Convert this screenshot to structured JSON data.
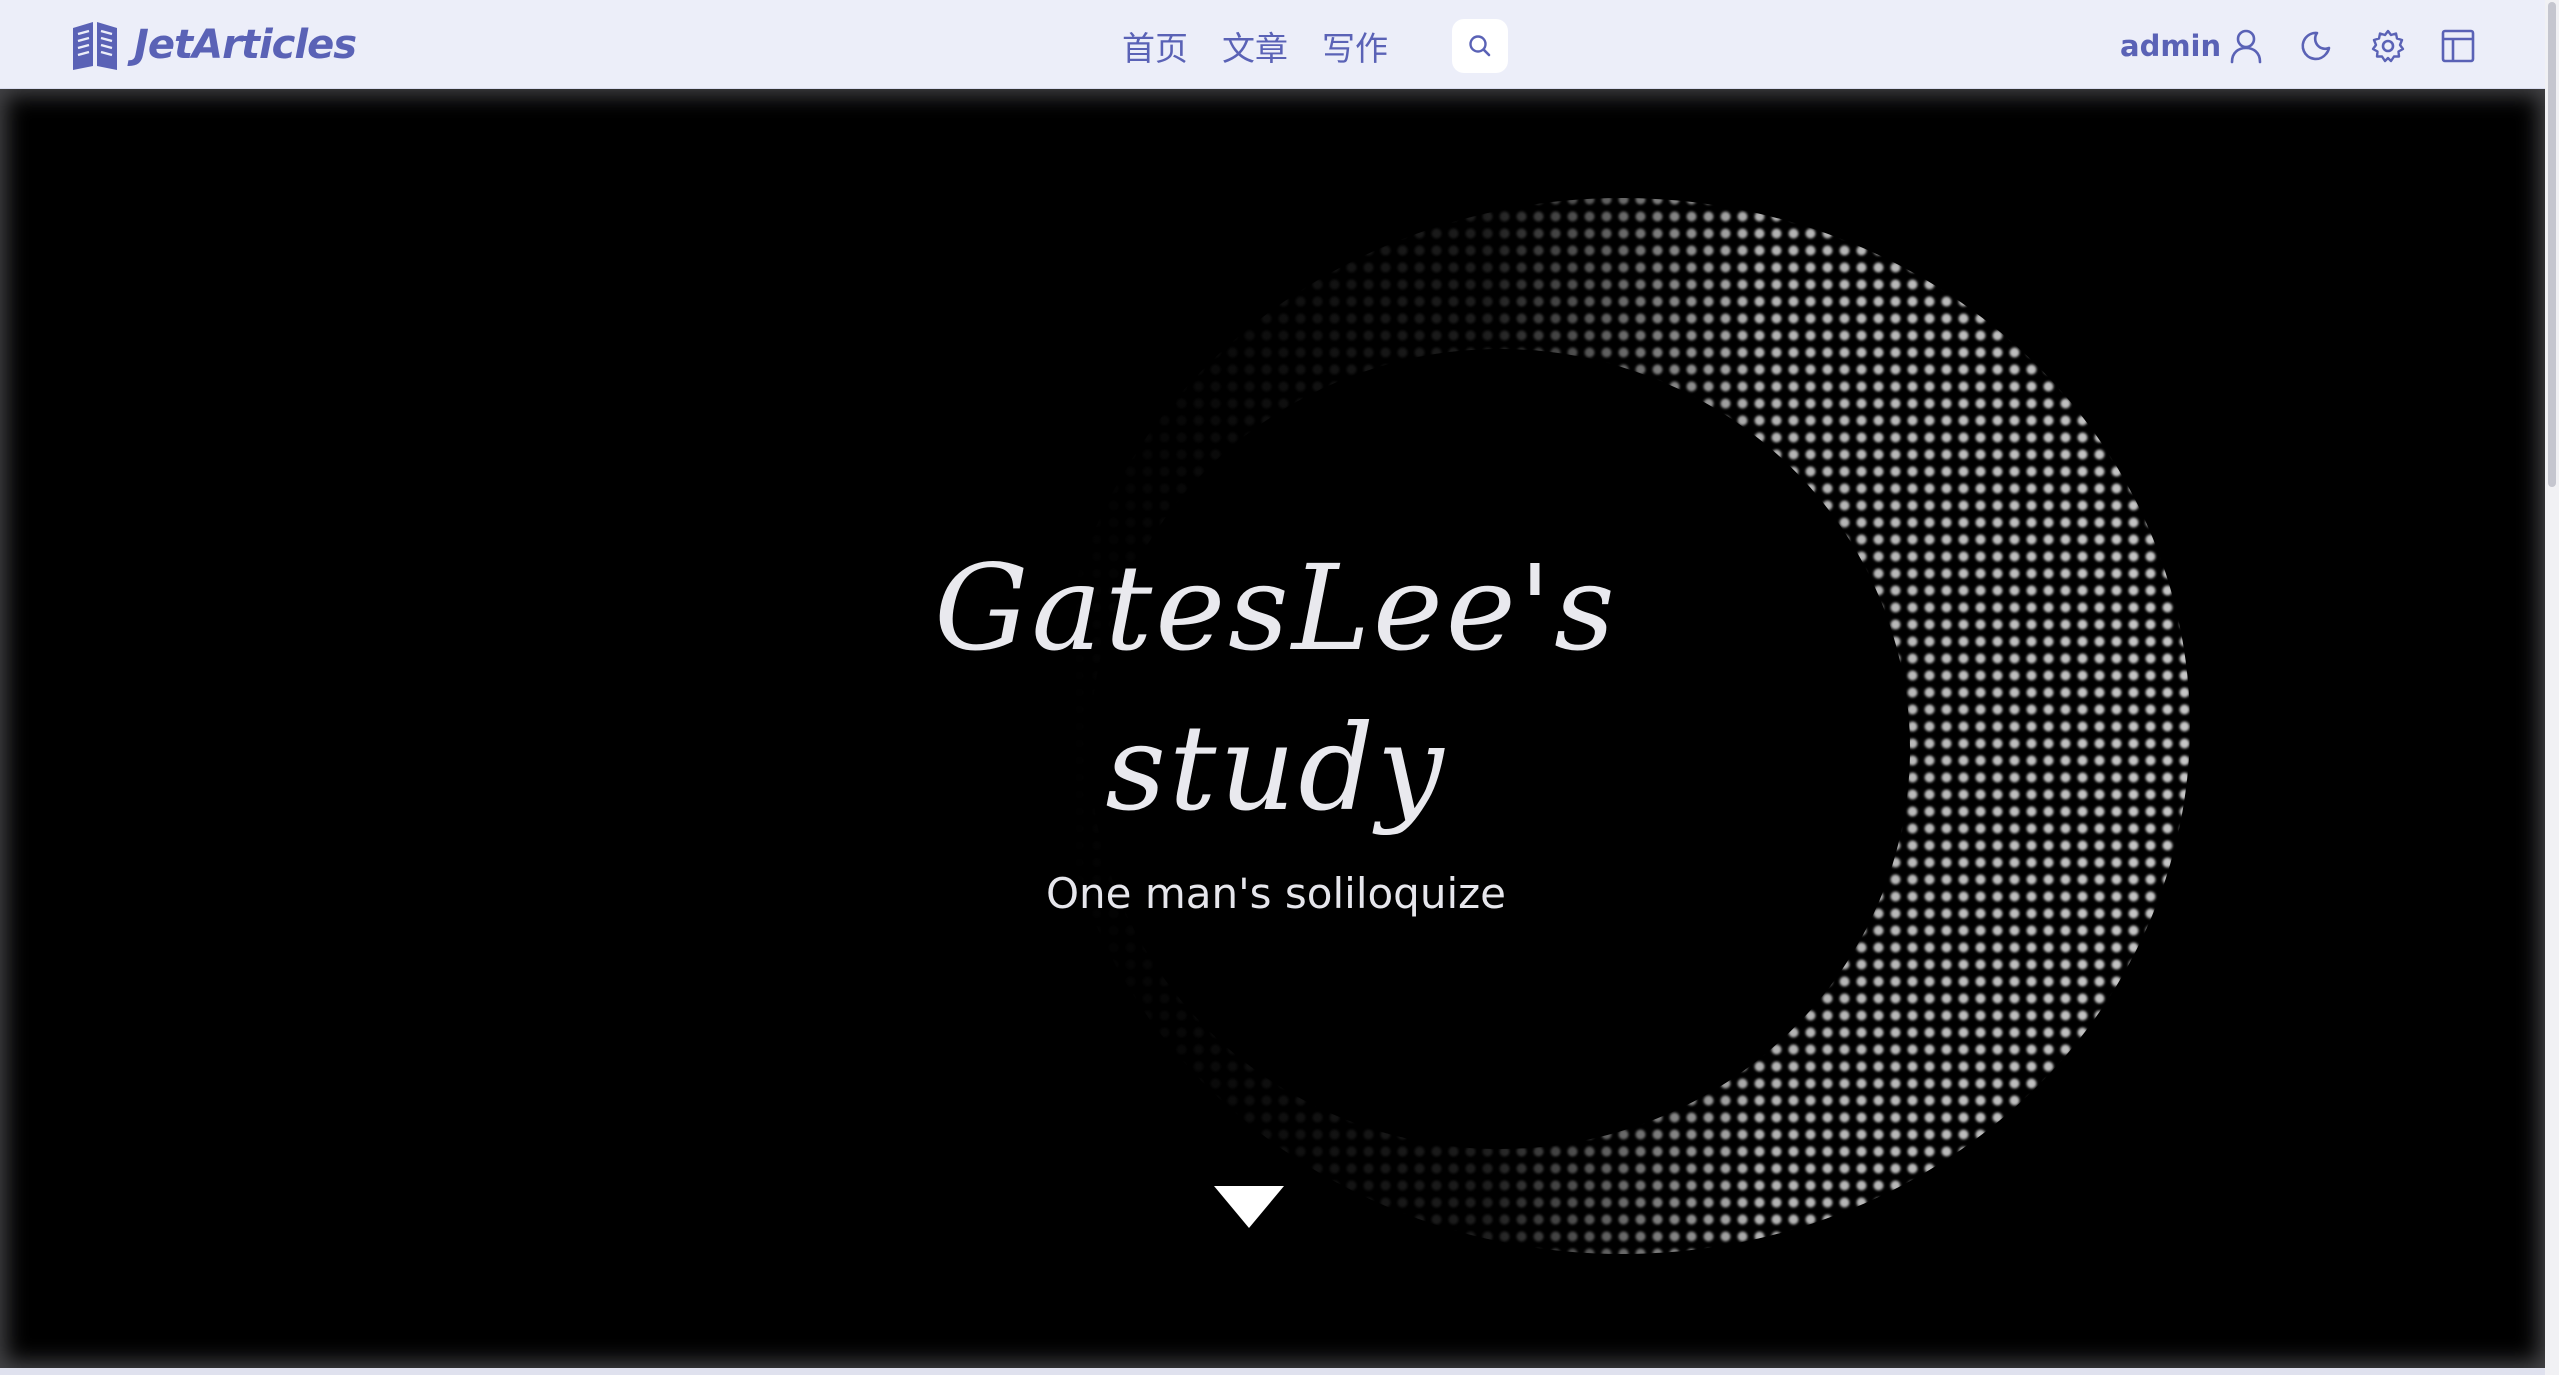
{
  "header": {
    "brand": {
      "name": "JetArticles",
      "icon": "open-book-icon"
    },
    "nav": [
      {
        "label": "首页"
      },
      {
        "label": "文章"
      },
      {
        "label": "写作"
      }
    ],
    "search": {
      "icon": "search-icon"
    },
    "user": {
      "name": "admin",
      "icon": "user-icon"
    },
    "tools": [
      {
        "name": "theme-toggle",
        "icon": "moon-icon"
      },
      {
        "name": "settings",
        "icon": "gear-icon"
      },
      {
        "name": "layout",
        "icon": "layout-icon"
      }
    ]
  },
  "hero": {
    "title_line1": "GatesLee's",
    "title_line2": "study",
    "subtitle": "One man's soliloquize",
    "scroll_icon": "triangle-down-icon"
  },
  "colors": {
    "brand": "#5a62b6",
    "topbar_bg": "#eceef9",
    "hero_bg": "#000000",
    "hero_text": "#e9e9ee"
  }
}
